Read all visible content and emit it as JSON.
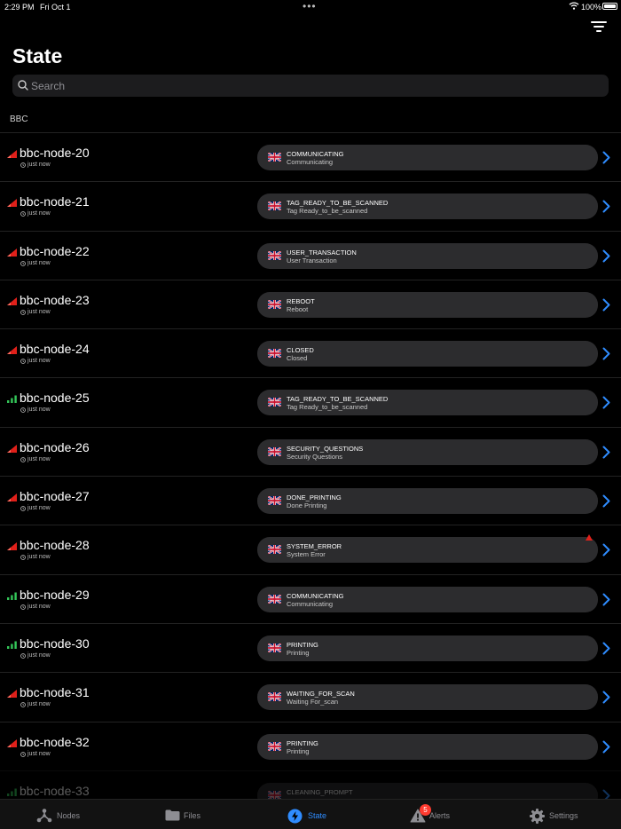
{
  "status_bar": {
    "time": "2:29 PM",
    "date": "Fri Oct 1",
    "battery": "100%"
  },
  "header": {
    "title": "State"
  },
  "search": {
    "placeholder": "Search"
  },
  "section": {
    "title": "BBC"
  },
  "rows": [
    {
      "name": "bbc-node-20",
      "updated": "just now",
      "signal": "red",
      "state_code": "COMMUNICATING",
      "state_desc": "Communicating",
      "alert": false
    },
    {
      "name": "bbc-node-21",
      "updated": "just now",
      "signal": "red",
      "state_code": "TAG_READY_TO_BE_SCANNED",
      "state_desc": "Tag Ready_to_be_scanned",
      "alert": false
    },
    {
      "name": "bbc-node-22",
      "updated": "just now",
      "signal": "red",
      "state_code": "USER_TRANSACTION",
      "state_desc": "User Transaction",
      "alert": false
    },
    {
      "name": "bbc-node-23",
      "updated": "just now",
      "signal": "red",
      "state_code": "REBOOT",
      "state_desc": "Reboot",
      "alert": false
    },
    {
      "name": "bbc-node-24",
      "updated": "just now",
      "signal": "red",
      "state_code": "CLOSED",
      "state_desc": "Closed",
      "alert": false
    },
    {
      "name": "bbc-node-25",
      "updated": "just now",
      "signal": "green",
      "state_code": "TAG_READY_TO_BE_SCANNED",
      "state_desc": "Tag Ready_to_be_scanned",
      "alert": false
    },
    {
      "name": "bbc-node-26",
      "updated": "just now",
      "signal": "red",
      "state_code": "SECURITY_QUESTIONS",
      "state_desc": "Security Questions",
      "alert": false
    },
    {
      "name": "bbc-node-27",
      "updated": "just now",
      "signal": "red",
      "state_code": "DONE_PRINTING",
      "state_desc": "Done Printing",
      "alert": false
    },
    {
      "name": "bbc-node-28",
      "updated": "just now",
      "signal": "red",
      "state_code": "SYSTEM_ERROR",
      "state_desc": "System Error",
      "alert": true
    },
    {
      "name": "bbc-node-29",
      "updated": "just now",
      "signal": "green",
      "state_code": "COMMUNICATING",
      "state_desc": "Communicating",
      "alert": false
    },
    {
      "name": "bbc-node-30",
      "updated": "just now",
      "signal": "green",
      "state_code": "PRINTING",
      "state_desc": "Printing",
      "alert": false
    },
    {
      "name": "bbc-node-31",
      "updated": "just now",
      "signal": "red",
      "state_code": "WAITING_FOR_SCAN",
      "state_desc": "Waiting For_scan",
      "alert": false
    },
    {
      "name": "bbc-node-32",
      "updated": "just now",
      "signal": "red",
      "state_code": "PRINTING",
      "state_desc": "Printing",
      "alert": false
    },
    {
      "name": "bbc-node-33",
      "updated": "",
      "signal": "green",
      "state_code": "CLEANING_PROMPT",
      "state_desc": "",
      "alert": false
    }
  ],
  "tabs": [
    {
      "label": "Nodes",
      "icon": "nodes-icon",
      "active": false
    },
    {
      "label": "Files",
      "icon": "folder-icon",
      "active": false
    },
    {
      "label": "State",
      "icon": "bolt-icon",
      "active": true
    },
    {
      "label": "Alerts",
      "icon": "warning-icon",
      "active": false,
      "badge": "5"
    },
    {
      "label": "Settings",
      "icon": "gear-icon",
      "active": false
    }
  ],
  "colors": {
    "accent": "#2f8cff",
    "signal_red": "#e0201a",
    "signal_green": "#34c759",
    "pill_bg": "#2c2c2e"
  }
}
